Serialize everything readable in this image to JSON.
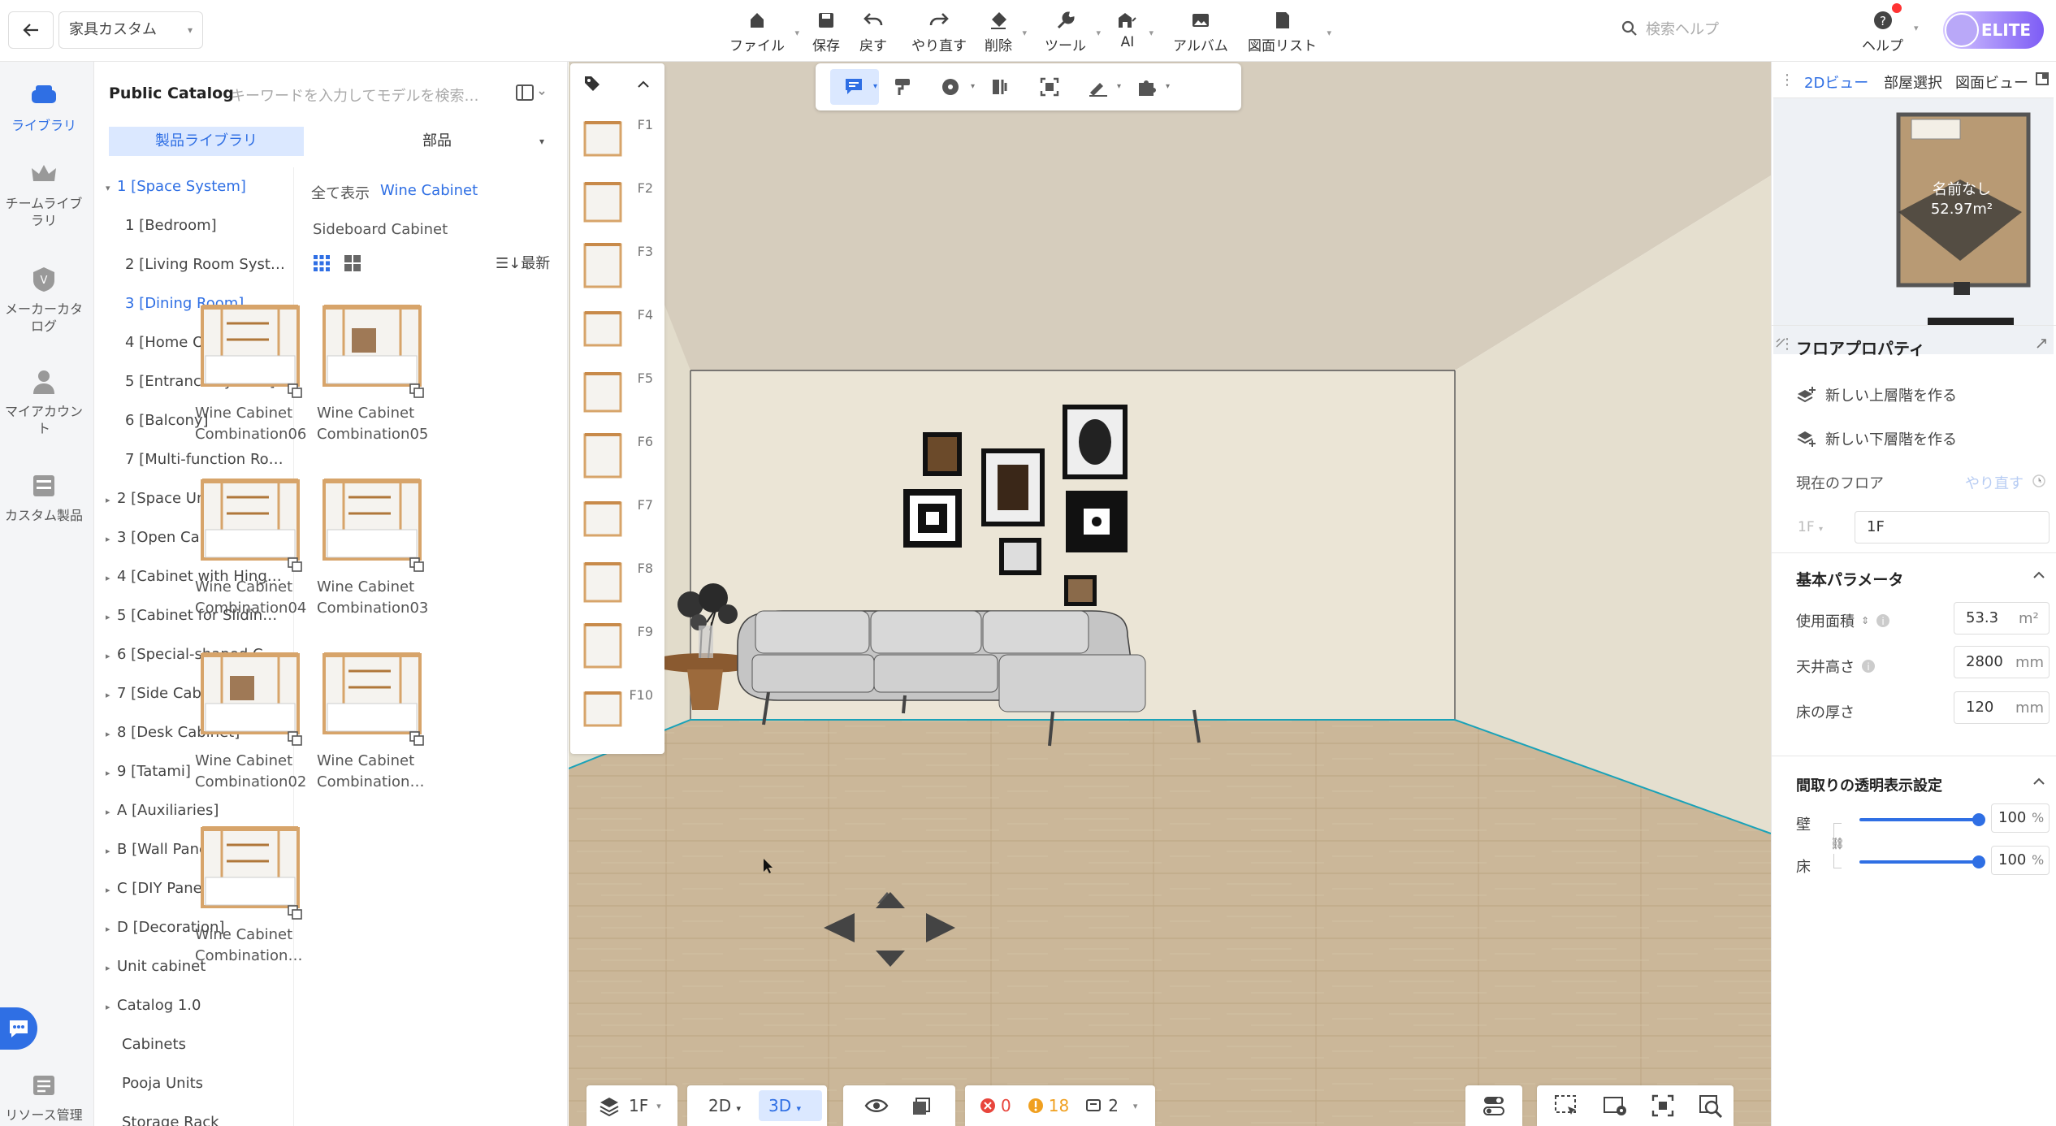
{
  "topbar": {
    "project": "家具カスタム",
    "file": "ファイル",
    "save": "保存",
    "undo": "戻す",
    "redo": "やり直す",
    "delete": "削除",
    "tools": "ツール",
    "ai": "AI",
    "album": "アルバム",
    "drawing_list": "図面リスト",
    "search_placeholder": "検索ヘルプ",
    "help": "ヘルプ",
    "badge": "ELITE"
  },
  "rail": {
    "library": "ライブラリ",
    "team_library": "チームライブラリ",
    "maker_catalog": "メーカーカタログ",
    "my_account": "マイアカウント",
    "custom_products": "カスタム製品",
    "resource_mgmt": "リソース管理"
  },
  "catalog": {
    "title": "Public Catalog",
    "search_placeholder": "キーワードを入力してモデルを検索…",
    "tab_products": "製品ライブラリ",
    "tab_parts": "部品",
    "tree": [
      {
        "label": "1 [Space System]",
        "arrow": "▾"
      },
      {
        "label": "1 [Bedroom]",
        "arrow": ""
      },
      {
        "label": "2 [Living Room Syst…",
        "arrow": ""
      },
      {
        "label": "3 [Dining Room]",
        "arrow": ""
      },
      {
        "label": "4 [Home Office Syst…",
        "arrow": ""
      },
      {
        "label": "5 [Entrance System]",
        "arrow": ""
      },
      {
        "label": "6 [Balcony]",
        "arrow": ""
      },
      {
        "label": "7 [Multi-function Ro…",
        "arrow": ""
      },
      {
        "label": "2 [Space Unit]",
        "arrow": "▸"
      },
      {
        "label": "3 [Open Cabinet]",
        "arrow": "▸"
      },
      {
        "label": "4 [Cabinet with Hing…",
        "arrow": "▸"
      },
      {
        "label": "5 [Cabinet for Slidin…",
        "arrow": "▸"
      },
      {
        "label": "6 [Special-shaped C…",
        "arrow": "▸"
      },
      {
        "label": "7 [Side Cabinet]",
        "arrow": "▸"
      },
      {
        "label": "8 [Desk Cabinet]",
        "arrow": "▸"
      },
      {
        "label": "9 [Tatami]",
        "arrow": "▸"
      },
      {
        "label": "A [Auxiliaries]",
        "arrow": "▸"
      },
      {
        "label": "B [Wall Panel]",
        "arrow": "▸"
      },
      {
        "label": "C [DIY Panel]",
        "arrow": "▸"
      },
      {
        "label": "D [Decoration]",
        "arrow": "▸"
      },
      {
        "label": "Unit cabinet",
        "arrow": "▸"
      },
      {
        "label": "Catalog 1.0",
        "arrow": "▸"
      },
      {
        "label": "Cabinets",
        "arrow": ""
      },
      {
        "label": "Pooja Units",
        "arrow": ""
      },
      {
        "label": "Storage Rack",
        "arrow": ""
      }
    ],
    "crumb_all": "全て表示",
    "crumb_current": "Wine Cabinet",
    "subcategory": "Sideboard Cabinet",
    "sort": "最新",
    "products": [
      {
        "l1": "Wine Cabinet",
        "l2": "Combination06"
      },
      {
        "l1": "Wine Cabinet",
        "l2": "Combination05"
      },
      {
        "l1": "Wine Cabinet",
        "l2": "Combination04"
      },
      {
        "l1": "Wine Cabinet",
        "l2": "Combination03"
      },
      {
        "l1": "Wine Cabinet",
        "l2": "Combination02"
      },
      {
        "l1": "Wine Cabinet",
        "l2": "Combination…"
      },
      {
        "l1": "Wine Cabinet",
        "l2": "Combination…"
      }
    ]
  },
  "floors": [
    "F1",
    "F2",
    "F3",
    "F4",
    "F5",
    "F6",
    "F7",
    "F8",
    "F9",
    "F10"
  ],
  "bottombar": {
    "floor": "1F",
    "mode_2d": "2D",
    "mode_3d": "3D",
    "errors": "0",
    "warnings": "18",
    "info": "2"
  },
  "right": {
    "tab_2d": "2Dビュー",
    "tab_room": "部屋選択",
    "tab_drawing": "図面ビュー",
    "room_name": "名前なし",
    "room_area": "52.97m²",
    "floor_props": "フロアプロパティ",
    "new_upper": "新しい上層階を作る",
    "new_lower": "新しい下層階を作る",
    "current_floor": "現在のフロア",
    "redo": "やり直す",
    "floor_select": "1F",
    "floor_name": "1F",
    "basic_params": "基本パラメータ",
    "area_label": "使用面積",
    "area_value": "53.3",
    "area_unit": "m²",
    "ceiling_label": "天井高さ",
    "ceiling_value": "2800",
    "ceiling_unit": "mm",
    "floor_thick_label": "床の厚さ",
    "floor_thick_value": "120",
    "floor_thick_unit": "mm",
    "transparency": "間取りの透明表示設定",
    "wall": "壁",
    "floor": "床",
    "wall_value": "100",
    "floor_value": "100",
    "pct": "%"
  },
  "colors": {
    "accent": "#2f6fe4",
    "wall": "#e9e3d4",
    "floor": "#c9b495"
  }
}
